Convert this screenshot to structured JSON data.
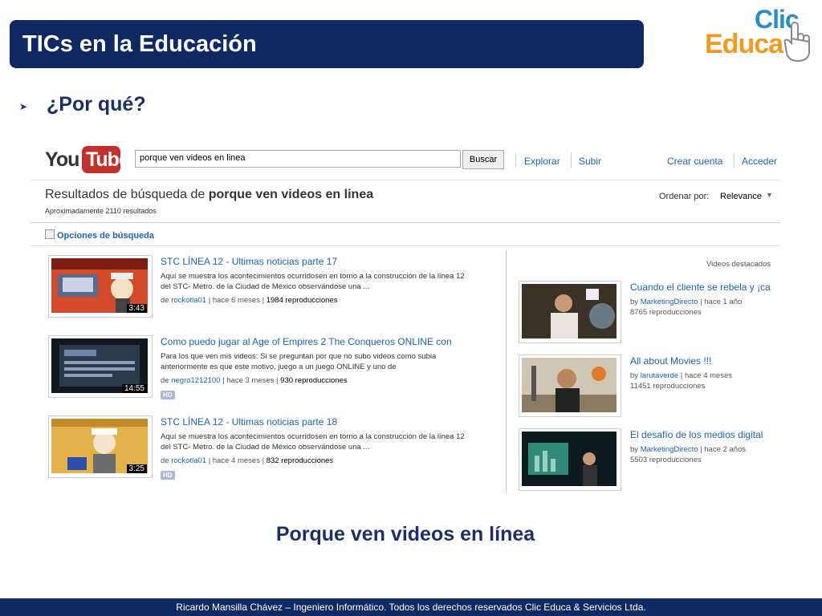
{
  "slide": {
    "title": "TICs en la Educación",
    "bullet": "¿Por qué?",
    "caption": "Porque ven videos en línea",
    "footer": "Ricardo Mansilla Chávez – Ingeniero Informático.  Todos los derechos reservados Clic Educa  &  Servicios Ltda.",
    "logo": {
      "top": "Clic",
      "bottom": "Educa",
      "icon": "pointing-hand-icon"
    },
    "bullet_icon": "arrow-bullet-icon",
    "colors": {
      "title_bar": "#0f2a63",
      "text_blue": "#1b2f6b",
      "logo_blue": "#2a8fc7",
      "logo_orange": "#f39a1e"
    }
  },
  "youtube": {
    "logo_you": "You",
    "logo_tube": "Tube",
    "search_value": "porque ven videos en linea",
    "search_button": "Buscar",
    "nav": {
      "explore": "Explorar",
      "upload": "Subir",
      "create_account": "Crear cuenta",
      "sign_in": "Acceder"
    },
    "results_prefix": "Resultados de búsqueda de ",
    "results_query": "porque ven videos en linea",
    "results_count": "Aproximadamente 2110 resultados",
    "order_label": "Ordenar por:",
    "order_value": "Relevance",
    "search_options": "Opciones de búsqueda",
    "featured_label": "Videos destacados",
    "results": [
      {
        "title": "STC LÍNEA 12 - Ultimas noticias parte 17",
        "desc": "Aquí se muestra los acontecimientos ocurridosen en torno a la construcción de la línea 12 del STC- Metro. de la Ciudad de México observándose una ...",
        "user": "rockotla01",
        "age": "hace 6 meses",
        "views": "1984 reproducciones",
        "duration": "3:43",
        "hd": ""
      },
      {
        "title": "Como puedo jugar al Age of Empires 2 The Conqueros ONLINE con",
        "desc": "Para los que ven mis videos: Si se preguntan por que no subo videos como subia anteriormente es que este motivo, juego a un juego ONLINE y uno de",
        "user": "negro1212100",
        "age": "hace 3 meses",
        "views": "930 reproducciones",
        "duration": "14:55",
        "hd": "HD"
      },
      {
        "title": "STC LÍNEA 12 - Ultimas noticias parte 18",
        "desc": "Aquí se muestra los acontecimientos ocurridosen en torno a la construcción de la línea 12 del STC- Metro. de la Ciudad de México observándose una ...",
        "user": "rockotla01",
        "age": "hace 4 meses",
        "views": "832 reproducciones",
        "duration": "3:25",
        "hd": "HD"
      }
    ],
    "featured": [
      {
        "title": "Cuando el cliente se rebela y ¡ca",
        "by": "by",
        "user": "MarketingDirecto",
        "age": "hace 1 año",
        "views": "8765 reproducciones"
      },
      {
        "title": "All about Movies !!!",
        "by": "by",
        "user": "larutaverde",
        "age": "hace 4 meses",
        "views": "11451 reproducciones"
      },
      {
        "title": "El desafío de los medios digital",
        "by": "by",
        "user": "MarketingDirecto",
        "age": "hace 2 años",
        "views": "5503 reproducciones"
      }
    ]
  }
}
